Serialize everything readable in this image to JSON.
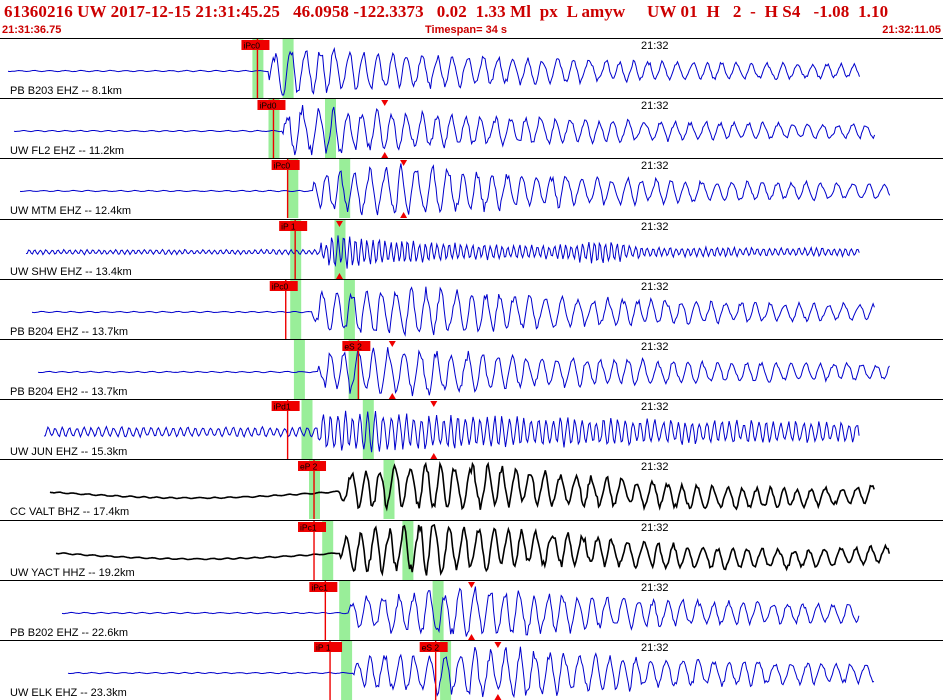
{
  "header": {
    "event_line": "61360216 UW 2017-12-15 21:31:45.25   46.0958 -122.3373   0.02  1.33 Ml  px  L amyw     UW 01  H   2  -  H S4   -1.08  1.10",
    "left_time": "21:31:36.75",
    "timespan": "Timespan=  34 s",
    "right_time": "21:32:11.05"
  },
  "colors": {
    "header_text": "#cc0000",
    "trace_blue": "#0000cc",
    "trace_black": "#000000",
    "pick_red": "#ee0000",
    "window_green": "#99ee99"
  },
  "traces": [
    {
      "label": "PB B203 EHZ -- 8.1km",
      "time_mark": "21:32",
      "color": "blue",
      "picks": [
        {
          "text": "iPc0",
          "pos": 0.273
        }
      ],
      "windows": [
        0.273,
        0.305
      ],
      "s_marker": null,
      "p_onset": 0.285,
      "env": "fast"
    },
    {
      "label": "UW FL2 EHZ -- 11.2km",
      "time_mark": "21:32",
      "color": "blue",
      "picks": [
        {
          "text": "iPd0",
          "pos": 0.29
        }
      ],
      "windows": [
        0.29,
        0.35
      ],
      "s_marker": 0.408,
      "p_onset": 0.3,
      "env": "fast"
    },
    {
      "label": "UW MTM EHZ -- 12.4km",
      "time_mark": "21:32",
      "color": "blue",
      "picks": [
        {
          "text": "iPc0",
          "pos": 0.305
        }
      ],
      "windows": [
        0.31,
        0.365
      ],
      "s_marker": 0.428,
      "p_onset": 0.332,
      "env": "slow"
    },
    {
      "label": "UW SHW EHZ -- 13.4km",
      "time_mark": "21:32",
      "color": "blue",
      "picks": [
        {
          "text": "iP 1",
          "pos": 0.313
        }
      ],
      "windows": [
        0.313,
        0.36
      ],
      "s_marker": 0.36,
      "p_onset": 0.34,
      "env": "burst"
    },
    {
      "label": "PB B204 EHZ -- 13.7km",
      "time_mark": "21:32",
      "color": "blue",
      "picks": [
        {
          "text": "iPc0",
          "pos": 0.303
        }
      ],
      "windows": [
        0.313,
        0.37
      ],
      "s_marker": null,
      "p_onset": 0.33,
      "env": "slow"
    },
    {
      "label": "PB B204 EH2 -- 13.7km",
      "time_mark": "21:32",
      "color": "blue",
      "picks": [
        {
          "text": "eS 2",
          "pos": 0.38
        }
      ],
      "windows": [
        0.317,
        0.375
      ],
      "s_marker": 0.416,
      "p_onset": 0.338,
      "env": "slow"
    },
    {
      "label": "UW JUN EHZ -- 15.3km",
      "time_mark": "21:32",
      "color": "blue",
      "picks": [
        {
          "text": "iPd1",
          "pos": 0.305
        }
      ],
      "windows": [
        0.325,
        0.39
      ],
      "s_marker": 0.46,
      "p_onset": 0.335,
      "env": "noisy"
    },
    {
      "label": "CC VALT BHZ -- 17.4km",
      "time_mark": "21:32",
      "color": "black",
      "picks": [
        {
          "text": "eP 2",
          "pos": 0.333
        }
      ],
      "windows": [
        0.333,
        0.412
      ],
      "s_marker": null,
      "p_onset": 0.36,
      "env": "drift"
    },
    {
      "label": "UW YACT HHZ -- 19.2km",
      "time_mark": "21:32",
      "color": "black",
      "picks": [
        {
          "text": "iPc1",
          "pos": 0.333
        }
      ],
      "windows": [
        0.347,
        0.432
      ],
      "s_marker": null,
      "p_onset": 0.36,
      "env": "drift"
    },
    {
      "label": "PB B202 EHZ -- 22.6km",
      "time_mark": "21:32",
      "color": "blue",
      "picks": [
        {
          "text": "iPc1",
          "pos": 0.345
        }
      ],
      "windows": [
        0.365,
        0.464
      ],
      "s_marker": 0.5,
      "p_onset": 0.37,
      "env": "slow"
    },
    {
      "label": "UW ELK EHZ -- 23.3km",
      "time_mark": "21:32",
      "color": "blue",
      "picks": [
        {
          "text": "iP 1",
          "pos": 0.35
        },
        {
          "text": "eS 2",
          "pos": 0.462
        }
      ],
      "windows": [
        0.367,
        0.472
      ],
      "s_marker": 0.528,
      "p_onset": 0.375,
      "env": "slow"
    }
  ]
}
